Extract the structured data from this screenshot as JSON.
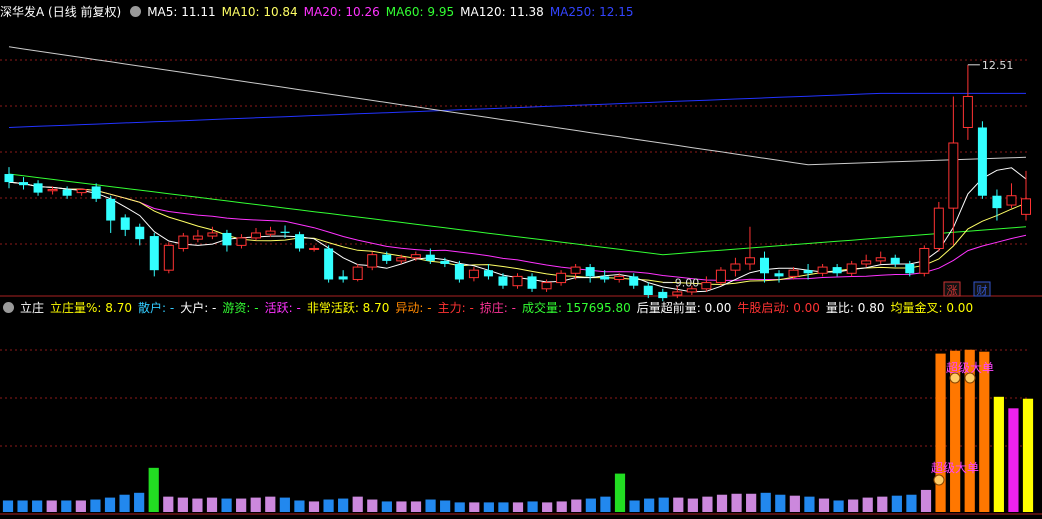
{
  "main_panel": {
    "stock_title": "深华发A (日线 前复权)",
    "ma_labels": [
      {
        "text": "MA5: 11.11",
        "color": "#ffffff"
      },
      {
        "text": "MA10: 10.84",
        "color": "#ffff66"
      },
      {
        "text": "MA20: 10.26",
        "color": "#ff33ff"
      },
      {
        "text": "MA60: 9.95",
        "color": "#33ff33"
      },
      {
        "text": "MA120: 11.38",
        "color": "#ffffff"
      },
      {
        "text": "MA250: 12.15",
        "color": "#3344ff"
      }
    ],
    "high_label": "12.51",
    "low_label": "9.00",
    "markers": [
      "涨",
      "财"
    ]
  },
  "sub_panel": {
    "indicator_name": "立庄",
    "items": [
      {
        "text": "立庄量%: 8.70",
        "color": "#ffff00"
      },
      {
        "text": "散户: -",
        "color": "#33ccff"
      },
      {
        "text": "大户: -",
        "color": "#ffffff"
      },
      {
        "text": "游资: -",
        "color": "#33ff33"
      },
      {
        "text": "活跃: -",
        "color": "#ff33ff"
      },
      {
        "text": "非常活跃: 8.70",
        "color": "#ffff00"
      },
      {
        "text": "异动: -",
        "color": "#ff8800"
      },
      {
        "text": "主力: -",
        "color": "#ff3333"
      },
      {
        "text": "掠庄: -",
        "color": "#ff3399"
      },
      {
        "text": "成交量: 157695.80",
        "color": "#33ff33"
      },
      {
        "text": "后量超前量: 0.00",
        "color": "#ffffff"
      },
      {
        "text": "牛股启动: 0.00",
        "color": "#ff3333"
      },
      {
        "text": "量比: 0.80",
        "color": "#ffffff"
      },
      {
        "text": "均量金叉: 0.00",
        "color": "#ffff00"
      }
    ],
    "annotations": [
      "超级大单",
      "超级大单"
    ]
  },
  "colors": {
    "up": "#ff3333",
    "down": "#33ffff",
    "grid": "#8b1a1a",
    "ma5": "#ffffff",
    "ma10": "#ffff66",
    "ma20": "#ff33ff",
    "ma60": "#33ff33",
    "ma120": "#cccccc",
    "ma250": "#2233ff",
    "vol_normal": "#cc88dd",
    "vol_blue": "#2288ee",
    "vol_green": "#22dd22",
    "vol_orange": "#ff7700",
    "vol_yellow": "#ffff00",
    "vol_magenta": "#ee22ee"
  },
  "chart_data": [
    {
      "type": "candlestick",
      "title": "深华发A (日线 前复权)",
      "ylim": [
        8.8,
        13.2
      ],
      "high_marker": 12.51,
      "low_marker": 9.0,
      "candles": [
        [
          10.75,
          10.62,
          10.86,
          10.52
        ],
        [
          10.62,
          10.57,
          10.7,
          10.5
        ],
        [
          10.6,
          10.45,
          10.65,
          10.4
        ],
        [
          10.48,
          10.5,
          10.55,
          10.42
        ],
        [
          10.5,
          10.4,
          10.55,
          10.35
        ],
        [
          10.45,
          10.5,
          10.52,
          10.4
        ],
        [
          10.55,
          10.35,
          10.6,
          10.3
        ],
        [
          10.35,
          10.0,
          10.4,
          9.8
        ],
        [
          10.05,
          9.85,
          10.1,
          9.75
        ],
        [
          9.9,
          9.7,
          9.95,
          9.6
        ],
        [
          9.75,
          9.2,
          9.8,
          9.1
        ],
        [
          9.2,
          9.6,
          9.65,
          9.15
        ],
        [
          9.55,
          9.75,
          9.8,
          9.5
        ],
        [
          9.7,
          9.75,
          9.85,
          9.65
        ],
        [
          9.75,
          9.8,
          9.9,
          9.7
        ],
        [
          9.8,
          9.6,
          9.85,
          9.5
        ],
        [
          9.6,
          9.72,
          9.78,
          9.55
        ],
        [
          9.72,
          9.8,
          9.88,
          9.68
        ],
        [
          9.78,
          9.83,
          9.9,
          9.74
        ],
        [
          9.82,
          9.8,
          9.92,
          9.72
        ],
        [
          9.78,
          9.55,
          9.82,
          9.5
        ],
        [
          9.55,
          9.55,
          9.6,
          9.5
        ],
        [
          9.55,
          9.05,
          9.6,
          9.0
        ],
        [
          9.1,
          9.05,
          9.2,
          9.0
        ],
        [
          9.05,
          9.25,
          9.3,
          9.02
        ],
        [
          9.25,
          9.45,
          9.5,
          9.2
        ],
        [
          9.45,
          9.35,
          9.5,
          9.3
        ],
        [
          9.35,
          9.4,
          9.45,
          9.3
        ],
        [
          9.4,
          9.45,
          9.5,
          9.35
        ],
        [
          9.45,
          9.35,
          9.55,
          9.3
        ],
        [
          9.35,
          9.3,
          9.4,
          9.25
        ],
        [
          9.3,
          9.05,
          9.35,
          9.0
        ],
        [
          9.08,
          9.2,
          9.25,
          9.02
        ],
        [
          9.2,
          9.1,
          9.3,
          9.05
        ],
        [
          9.1,
          8.95,
          9.15,
          8.9
        ],
        [
          8.95,
          9.1,
          9.15,
          8.9
        ],
        [
          9.1,
          8.9,
          9.15,
          8.85
        ],
        [
          8.9,
          9.0,
          9.05,
          8.85
        ],
        [
          9.0,
          9.15,
          9.2,
          8.95
        ],
        [
          9.15,
          9.25,
          9.3,
          9.05
        ],
        [
          9.25,
          9.1,
          9.3,
          9.0
        ],
        [
          9.1,
          9.05,
          9.2,
          9.0
        ],
        [
          9.05,
          9.1,
          9.15,
          9.0
        ],
        [
          9.1,
          8.95,
          9.15,
          8.9
        ],
        [
          8.95,
          8.8,
          9.0,
          8.75
        ],
        [
          8.85,
          8.75,
          8.9,
          8.7
        ],
        [
          8.8,
          8.85,
          8.95,
          8.75
        ],
        [
          8.85,
          8.9,
          8.95,
          8.8
        ],
        [
          8.9,
          9.0,
          9.1,
          8.85
        ],
        [
          9.0,
          9.2,
          9.25,
          8.95
        ],
        [
          9.2,
          9.3,
          9.4,
          9.1
        ],
        [
          9.3,
          9.4,
          9.9,
          9.2
        ],
        [
          9.4,
          9.15,
          9.5,
          9.0
        ],
        [
          9.15,
          9.1,
          9.2,
          9.0
        ],
        [
          9.1,
          9.2,
          9.25,
          9.05
        ],
        [
          9.2,
          9.15,
          9.3,
          9.05
        ],
        [
          9.15,
          9.25,
          9.3,
          9.1
        ],
        [
          9.25,
          9.15,
          9.3,
          9.1
        ],
        [
          9.15,
          9.3,
          9.35,
          9.1
        ],
        [
          9.3,
          9.35,
          9.45,
          9.25
        ],
        [
          9.35,
          9.4,
          9.5,
          9.3
        ],
        [
          9.4,
          9.3,
          9.45,
          9.25
        ],
        [
          9.3,
          9.15,
          9.35,
          9.1
        ],
        [
          9.15,
          9.55,
          9.6,
          9.1
        ],
        [
          9.55,
          10.2,
          10.3,
          9.5
        ],
        [
          10.2,
          11.25,
          12.0,
          9.6
        ],
        [
          11.5,
          12.0,
          12.51,
          11.3
        ],
        [
          11.5,
          10.4,
          11.6,
          10.35
        ],
        [
          10.4,
          10.2,
          10.5,
          10.0
        ],
        [
          10.25,
          10.4,
          10.6,
          10.2
        ],
        [
          10.1,
          10.35,
          10.8,
          10.0
        ]
      ]
    },
    {
      "type": "bar",
      "title": "立庄",
      "ylim": [
        0,
        20
      ],
      "values": [
        1.2,
        1.2,
        1.2,
        1.2,
        1.2,
        1.2,
        1.3,
        1.5,
        1.8,
        2.0,
        4.6,
        1.6,
        1.5,
        1.4,
        1.5,
        1.4,
        1.4,
        1.5,
        1.6,
        1.5,
        1.2,
        1.1,
        1.3,
        1.4,
        1.6,
        1.3,
        1.1,
        1.1,
        1.1,
        1.3,
        1.2,
        1.0,
        1.0,
        1.0,
        1.0,
        1.0,
        1.1,
        1.0,
        1.1,
        1.3,
        1.4,
        1.6,
        4.0,
        1.2,
        1.4,
        1.5,
        1.5,
        1.4,
        1.6,
        1.8,
        1.9,
        1.9,
        2.0,
        1.8,
        1.7,
        1.6,
        1.4,
        1.2,
        1.3,
        1.5,
        1.6,
        1.7,
        1.8,
        2.3,
        16.5,
        16.8,
        16.9,
        16.7,
        12.0,
        10.8,
        11.8
      ],
      "colors": [
        "n",
        "n",
        "n",
        "n",
        "n",
        "n",
        "n",
        "n",
        "n",
        "n",
        "g",
        "n",
        "n",
        "n",
        "n",
        "n",
        "n",
        "n",
        "n",
        "n",
        "n",
        "n",
        "n",
        "n",
        "n",
        "n",
        "n",
        "n",
        "n",
        "n",
        "n",
        "n",
        "n",
        "n",
        "n",
        "n",
        "n",
        "n",
        "n",
        "n",
        "n",
        "n",
        "g",
        "n",
        "n",
        "n",
        "n",
        "n",
        "n",
        "n",
        "n",
        "n",
        "n",
        "n",
        "n",
        "n",
        "n",
        "n",
        "n",
        "n",
        "n",
        "n",
        "n",
        "n",
        "o",
        "o",
        "o",
        "o",
        "y",
        "m",
        "y"
      ]
    }
  ]
}
